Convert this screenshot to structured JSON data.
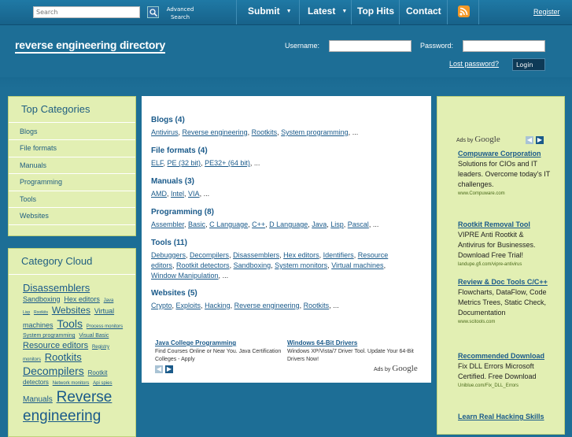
{
  "topbar": {
    "search_placeholder": "Search",
    "advanced_search": "Advanced Search",
    "nav": [
      {
        "label": "Submit",
        "has_menu": true
      },
      {
        "label": "Latest",
        "has_menu": true
      },
      {
        "label": "Top Hits",
        "has_menu": false
      },
      {
        "label": "Contact",
        "has_menu": false
      }
    ],
    "caret": "▼",
    "register": "Register"
  },
  "header": {
    "logo": "reverse engineering directory",
    "username_label": "Username:",
    "password_label": "Password:",
    "lost_password": "Lost password?",
    "login_button": "Login"
  },
  "sidebar": {
    "top_categories": {
      "title": "Top Categories",
      "items": [
        "Blogs",
        "File formats",
        "Manuals",
        "Programming",
        "Tools",
        "Websites"
      ]
    },
    "category_cloud": {
      "title": "Category Cloud",
      "tags": [
        {
          "label": "Disassemblers",
          "size": 13
        },
        {
          "label": "Sandboxing",
          "size": 9
        },
        {
          "label": "Hex editors",
          "size": 9
        },
        {
          "label": "Java",
          "size": 6
        },
        {
          "label": "Lisp",
          "size": 5
        },
        {
          "label": "Rootkits",
          "size": 5
        },
        {
          "label": "Websites",
          "size": 12
        },
        {
          "label": "Virtual machines",
          "size": 9
        },
        {
          "label": "Tools",
          "size": 14
        },
        {
          "label": "Process monitors",
          "size": 6
        },
        {
          "label": "System programming",
          "size": 7
        },
        {
          "label": "Visual Basic",
          "size": 7
        },
        {
          "label": "Resource editors",
          "size": 11
        },
        {
          "label": "Registry monitors",
          "size": 6
        },
        {
          "label": "Rootkits",
          "size": 13
        },
        {
          "label": "Decompilers",
          "size": 14
        },
        {
          "label": "Rootkit detectors",
          "size": 8
        },
        {
          "label": "Network monitors",
          "size": 6
        },
        {
          "label": "Api spies",
          "size": 6
        },
        {
          "label": "Manuals",
          "size": 10
        },
        {
          "label": "Reverse engineering",
          "size": 19
        }
      ]
    }
  },
  "main": {
    "sections": [
      {
        "title": "Blogs (4)",
        "links": [
          "Antivirus",
          "Reverse engineering",
          "Rootkits",
          "System programming"
        ]
      },
      {
        "title": "File formats (4)",
        "links": [
          "ELF",
          "PE (32 bit)",
          "PE32+ (64 bit)"
        ]
      },
      {
        "title": "Manuals (3)",
        "links": [
          "AMD",
          "Intel",
          "VIA"
        ]
      },
      {
        "title": "Programming (8)",
        "links": [
          "Assembler",
          "Basic",
          "C Language",
          "C++",
          "D Language",
          "Java",
          "Lisp",
          "Pascal"
        ]
      },
      {
        "title": "Tools (11)",
        "links": [
          "Debuggers",
          "Decompilers",
          "Disassemblers",
          "Hex editors",
          "Identifiers",
          "Resource editors",
          "Rootkit detectors",
          "Sandboxing",
          "System monitors",
          "Virtual machines",
          "Window Manipulation"
        ]
      },
      {
        "title": "Websites (5)",
        "links": [
          "Crypto",
          "Exploits",
          "Hacking",
          "Reverse engineering",
          "Rootkits"
        ]
      }
    ],
    "ellipsis": "...",
    "ads": [
      {
        "title": "Java College Programming",
        "desc": "Find Courses Online or Near You. Java Certification Colleges - Apply"
      },
      {
        "title": "Windows 64-Bit Drivers",
        "desc": "Windows XP/Vista/7 Driver Tool. Update Your 64-Bit Drivers Now!"
      }
    ],
    "ads_by": "Ads by",
    "google": "Google"
  },
  "right_ads": {
    "ads_by": "Ads by",
    "google": "Google",
    "ads": [
      {
        "title": "Compuware Corporation",
        "desc": "Solutions for CIOs and IT leaders. Overcome today's IT challenges.",
        "url": "www.Compuware.com"
      },
      {
        "title": "Rootkit Removal Tool",
        "desc": "VIPRE Anti Rootkit & Antivirus for Businesses. Download Free Trial!",
        "url": "landupe.gfi.com/vipre-antivirus"
      },
      {
        "title": "Review & Doc Tools C/C++",
        "desc": "Flowcharts, DataFlow, Code Metrics Trees, Static Check, Documentation",
        "url": "www.scitools.com"
      },
      {
        "title": "Recommended Download",
        "desc": "Fix DLL Errors Microsoft Certified. Free Download",
        "url": "Uniblue.com/Fix_DLL_Errors"
      },
      {
        "title": "Learn Real Hacking Skills",
        "desc": "",
        "url": ""
      }
    ]
  },
  "colors": {
    "background": "#1d6e96",
    "panel": "#e2efb3",
    "link": "#1a5a8a",
    "rss": "#f39826"
  }
}
